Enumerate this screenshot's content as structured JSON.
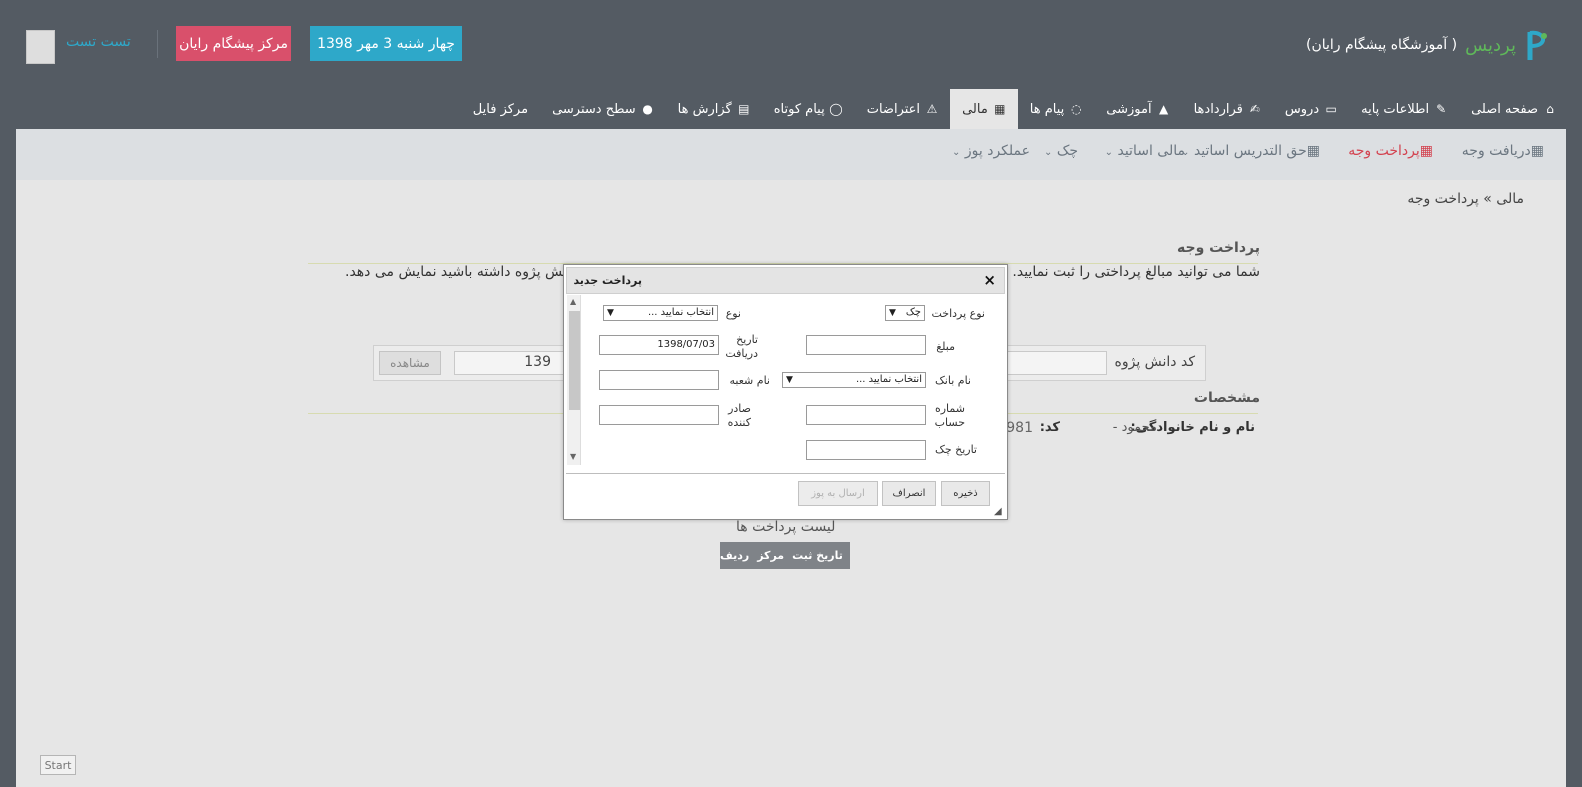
{
  "header": {
    "brand_name": "پرديس",
    "brand_sub": "( آموزشگاه پيشگام رايان)",
    "date": "چهار شنبه 3 مهر 1398",
    "center": "مرکز پیشگام رایان",
    "user": "تست تست"
  },
  "main_tabs": [
    {
      "label": "صفحه اصلی",
      "icon": "home-icon"
    },
    {
      "label": "اطلاعات پايه",
      "icon": "wrench-icon"
    },
    {
      "label": "دروس",
      "icon": "folder-icon"
    },
    {
      "label": "قراردادها",
      "icon": "edit-icon"
    },
    {
      "label": "آموزشی",
      "icon": "graduation-cap-icon"
    },
    {
      "label": "پيام ها",
      "icon": "comments-icon"
    },
    {
      "label": "مالی",
      "icon": "calculator-icon"
    },
    {
      "label": "اعتراضات",
      "icon": "warning-icon"
    },
    {
      "label": "پيام کوتاه",
      "icon": "comment-icon"
    },
    {
      "label": "گزارش ها",
      "icon": "document-icon"
    },
    {
      "label": "سطح دسترسی",
      "icon": "access-icon"
    },
    {
      "label": "مرکز فایل",
      "icon": ""
    }
  ],
  "sub_nav": {
    "receive": "دریافت وجه",
    "pay": "پرداخت وجه",
    "teacher_fee": "حق التدريس اساتيد",
    "teacher_finance": "مالی اساتيد",
    "check": "چک",
    "pos": "عملکرد پوز"
  },
  "breadcrumb": "مالی » پرداخت وجه",
  "page": {
    "title": "پرداخت وجه",
    "desc_right": "شما می توانید مبالغ پرداختی را ثبت نمایید. کا",
    "desc_left": "انش پژوه داشته باشید نمایش می دهد.",
    "search_label": "کد دانش پژوه",
    "search_value": "139",
    "view_label": "مشاهده",
    "specs_title": "مشخصات",
    "name_label": "نام و نام خانوادگی:",
    "name_value": "محمود -",
    "code_label": "کد:",
    "code_value": "981",
    "list_title": "لیست پرداخت ها",
    "list_columns": [
      "ردیف",
      "مرکز",
      "تاریخ ثبت"
    ],
    "start_label": "Start"
  },
  "dialog": {
    "title": "پرداخت جدید",
    "close": "×",
    "payment_type_label": "نوع پرداخت",
    "payment_type_value": "چک",
    "type_label": "نوع",
    "type_value": "انتخاب نمایید ...",
    "amount_label": "مبلغ",
    "amount_value": "",
    "receive_date_label": "تاریخ دریافت",
    "receive_date_value": "1398/07/03",
    "bank_label": "نام بانک",
    "bank_value": "انتخاب نمایید ...",
    "branch_label": "نام شعبه",
    "branch_value": "",
    "account_label": "شماره حساب",
    "account_value": "",
    "issuer_label": "صادر کننده",
    "issuer_value": "",
    "check_date_label": "تاریخ چک",
    "check_date_value": "",
    "save": "ذخیره",
    "cancel": "انصراف",
    "send_pos": "ارسال به پوز"
  },
  "colors": {
    "header_bg": "#545b63",
    "date_box": "#2ea8c9",
    "center_box": "#d9506b",
    "active_subnav": "#d3424f",
    "brand_green": "#5fb85a"
  }
}
